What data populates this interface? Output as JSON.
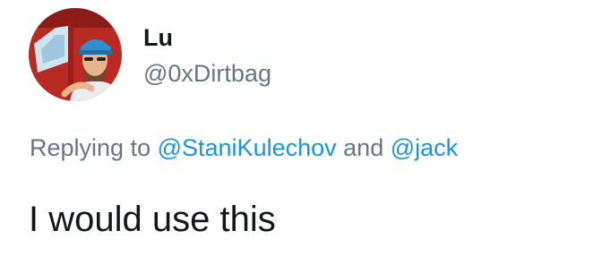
{
  "author": {
    "display_name": "Lu",
    "handle": "@0xDirtbag",
    "avatar": "profile-photo"
  },
  "reply_context": {
    "prefix": "Replying to",
    "mentions": [
      "@StaniKulechov",
      "@jack"
    ],
    "conjunction": "and"
  },
  "tweet": {
    "text": "I would use this"
  },
  "colors": {
    "text": "#14171a",
    "secondary": "#657786",
    "link": "#1b95e0"
  }
}
